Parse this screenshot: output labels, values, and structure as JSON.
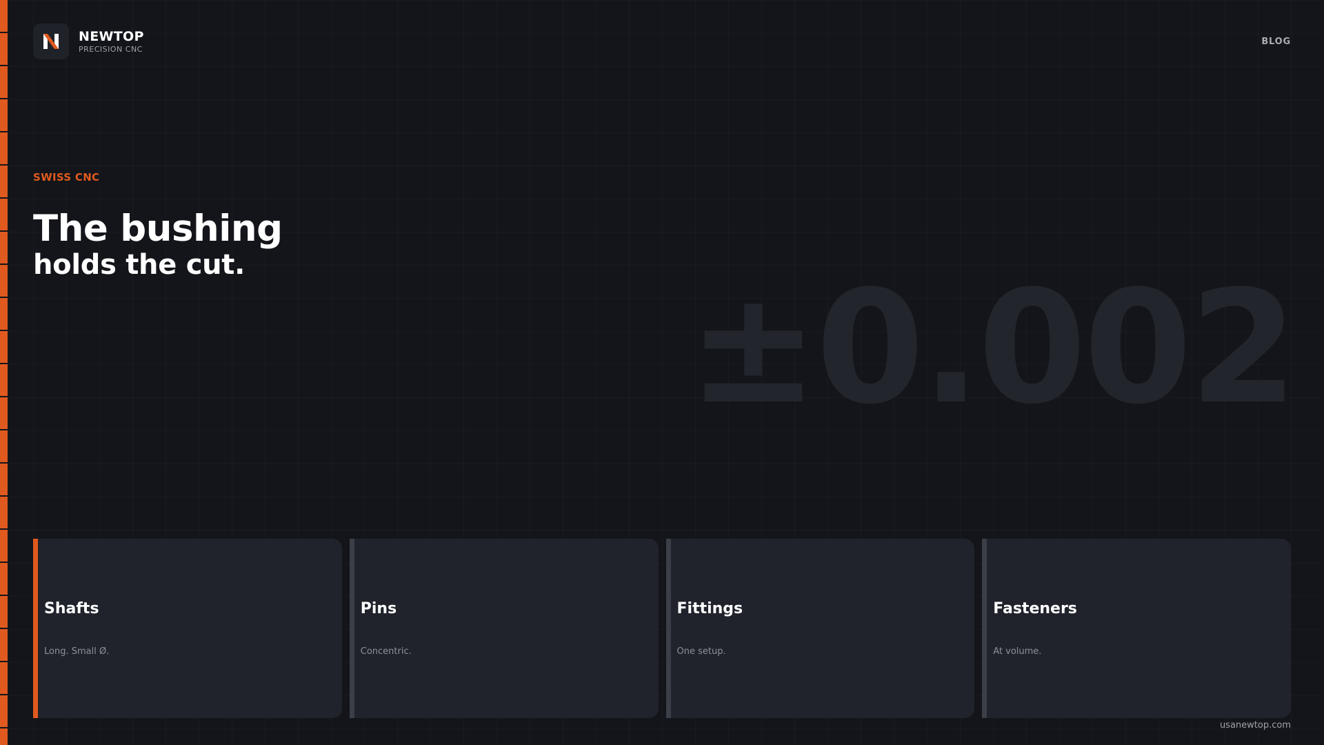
{
  "brand": {
    "logo_letter": "N",
    "name": "NEWTOP",
    "tagline": "PRECISION CNC"
  },
  "nav": {
    "blog_label": "BLOG"
  },
  "hero": {
    "eyebrow": "SWISS CNC",
    "headline_line1": "The bushing",
    "headline_line2": "holds the cut.",
    "tolerance": "±0.002"
  },
  "cards": [
    {
      "title": "Shafts",
      "description": "Long. Small Ø.",
      "active": true
    },
    {
      "title": "Pins",
      "description": "Concentric.",
      "active": false
    },
    {
      "title": "Fittings",
      "description": "One setup.",
      "active": false
    },
    {
      "title": "Fasteners",
      "description": "At volume.",
      "active": false
    }
  ],
  "footer": {
    "url": "usanewtop.com"
  },
  "colors": {
    "background": "#13151a",
    "accent": "#e05a1f",
    "card": "#20232b",
    "muted_border": "#3b3f48"
  },
  "icons": {
    "logo": "newtop-n-logo-icon"
  }
}
